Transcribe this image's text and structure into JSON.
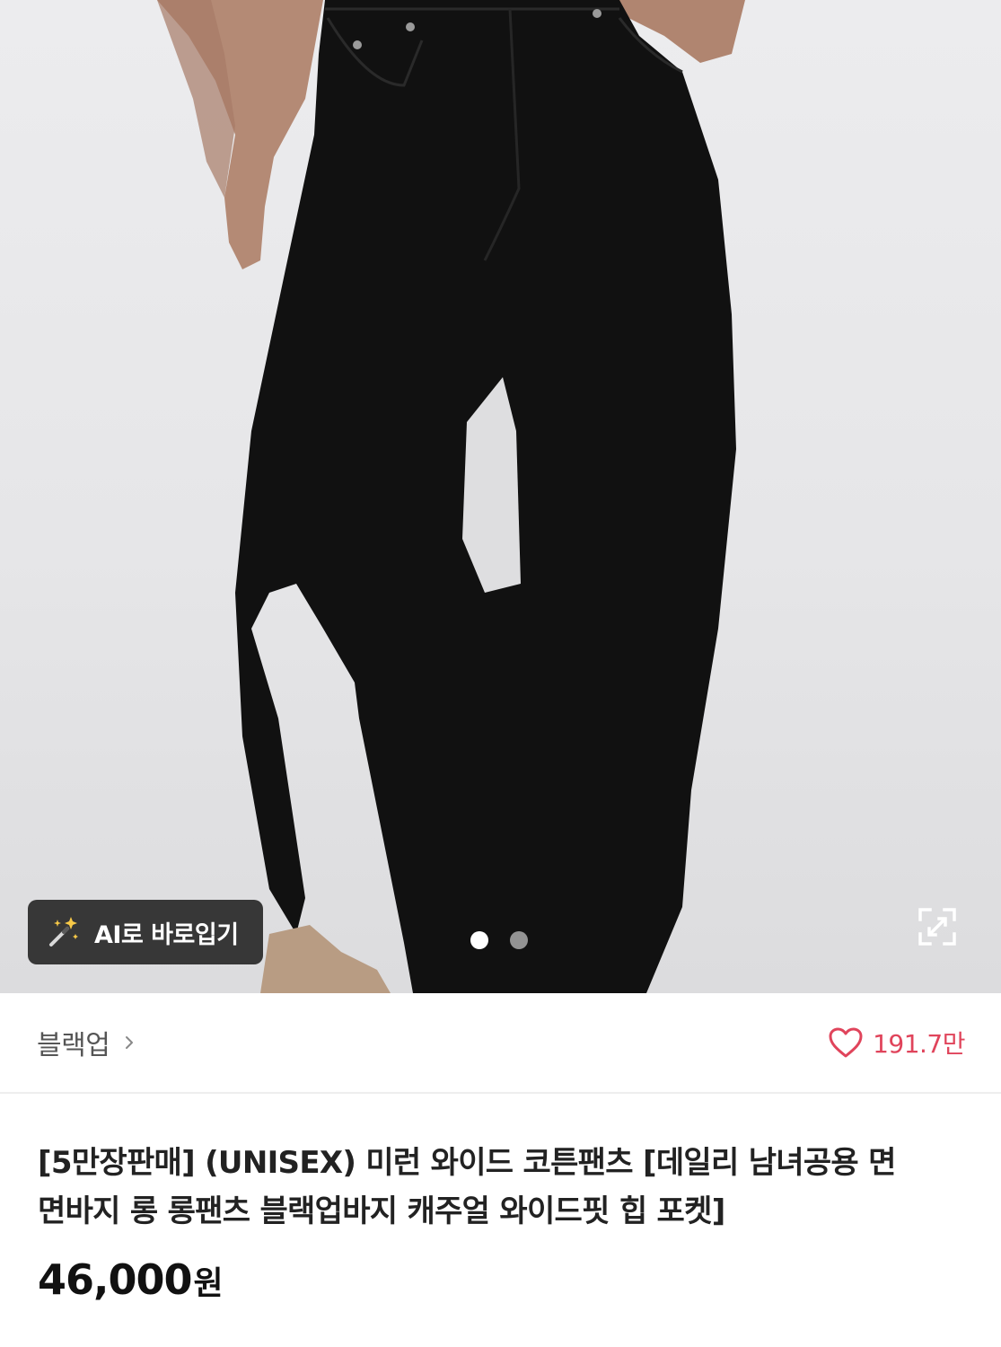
{
  "hero": {
    "ai_button_label": "AI로 바로입기",
    "carousel": {
      "count": 2,
      "active_index": 0
    },
    "wand_icon": "magic-wand-icon",
    "expand_icon": "fullscreen-expand-icon"
  },
  "brand": {
    "name": "블랙업",
    "chevron_icon": "chevron-right-icon"
  },
  "likes": {
    "icon": "heart-outline-icon",
    "count": "191.7만",
    "color": "#e0445b"
  },
  "product": {
    "title": "[5만장판매] (UNISEX) 미런 와이드 코튼팬츠 [데일리 남녀공용 면 면바지 롱 롱팬츠 블랙업바지 캐주얼 와이드핏 힙 포켓]",
    "price": "46,000",
    "currency": "원"
  }
}
